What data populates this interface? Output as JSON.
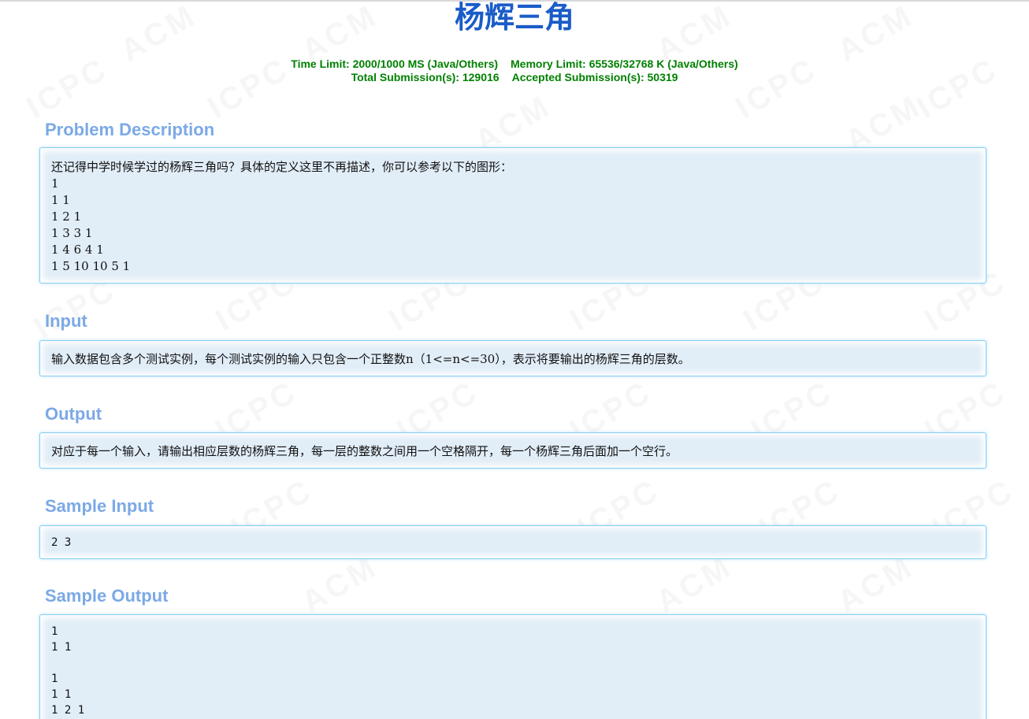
{
  "title": "杨辉三角",
  "limits": {
    "time_limit": "Time Limit: 2000/1000 MS (Java/Others)",
    "memory_limit": "Memory Limit: 65536/32768 K (Java/Others)",
    "total_submissions": "Total Submission(s): 129016",
    "accepted_submissions": "Accepted Submission(s): 50319"
  },
  "watermark": {
    "text_acm": "ACM",
    "text_icpc": "ICPC"
  },
  "sections": {
    "description": {
      "heading": "Problem Description",
      "lines": [
        "还记得中学时候学过的杨辉三角吗？具体的定义这里不再描述，你可以参考以下的图形：",
        "1",
        "1 1",
        "1 2 1",
        "1 3 3 1",
        "1 4 6 4 1",
        "1 5 10 10 5 1"
      ]
    },
    "input": {
      "heading": "Input",
      "text": "输入数据包含多个测试实例，每个测试实例的输入只包含一个正整数n（1<=n<=30），表示将要输出的杨辉三角的层数。"
    },
    "output": {
      "heading": "Output",
      "text": "对应于每一个输入，请输出相应层数的杨辉三角，每一层的整数之间用一个空格隔开，每一个杨辉三角后面加一个空行。"
    },
    "sample_input": {
      "heading": "Sample Input",
      "text": "2 3"
    },
    "sample_output": {
      "heading": "Sample Output",
      "lines": [
        "1",
        "1 1",
        "",
        "1",
        "1 1",
        "1 2 1"
      ]
    }
  }
}
